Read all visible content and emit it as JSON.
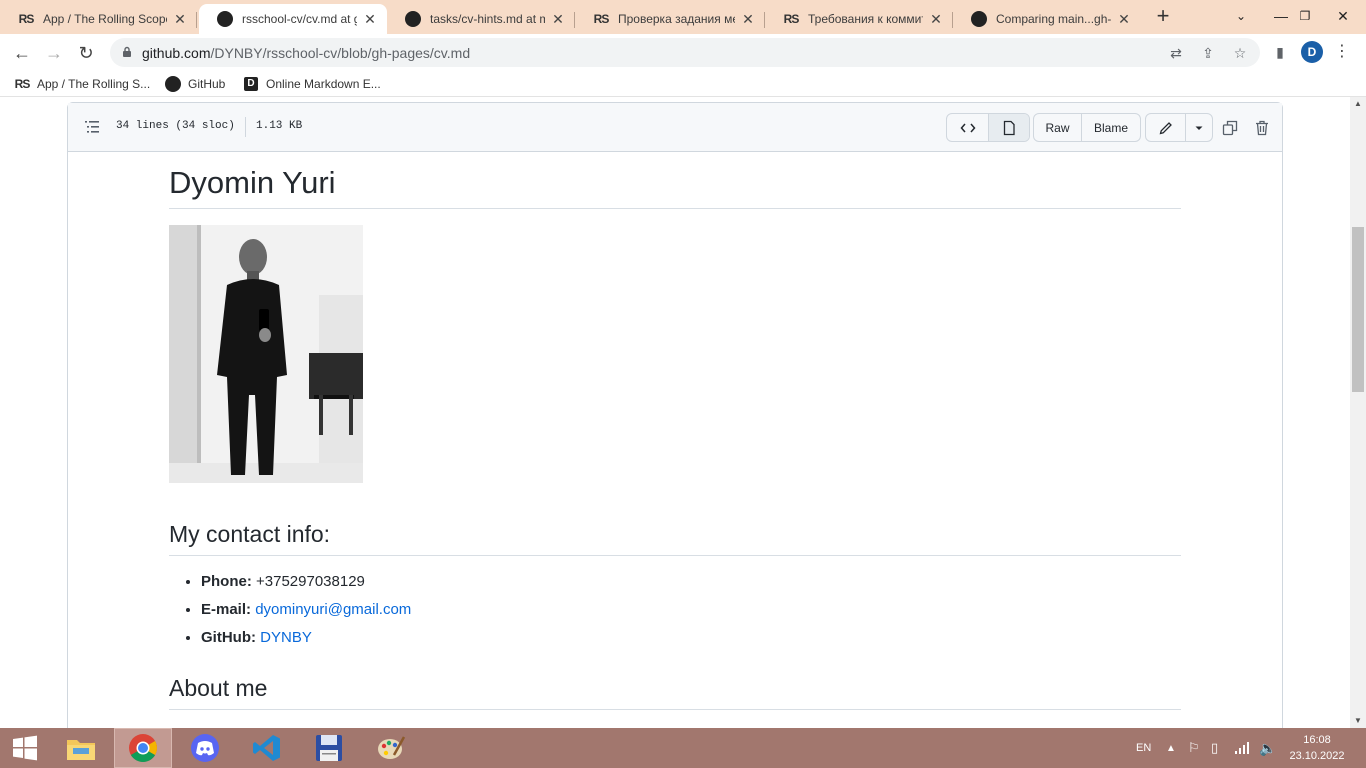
{
  "browser": {
    "tabs": [
      {
        "title": "App / The Rolling Scopes",
        "favicon": "rs-icon",
        "active": false
      },
      {
        "title": "rsschool-cv/cv.md at gh-pages",
        "favicon": "github-icon",
        "active": true
      },
      {
        "title": "tasks/cv-hints.md at master",
        "favicon": "github-icon",
        "active": false
      },
      {
        "title": "Проверка задания ментором",
        "favicon": "rs-icon",
        "active": false
      },
      {
        "title": "Требования к коммитам",
        "favicon": "rs-icon",
        "active": false
      },
      {
        "title": "Comparing main...gh-pages",
        "favicon": "github-icon",
        "active": false
      }
    ],
    "new_tab": "+",
    "address": {
      "host": "github.com",
      "path": "/DYNBY/rsschool-cv/blob/gh-pages/cv.md"
    },
    "profile_initial": "D",
    "bookmarks": [
      {
        "label": "App / The Rolling S...",
        "icon": "rs-icon"
      },
      {
        "label": "GitHub",
        "icon": "github-icon"
      },
      {
        "label": "Online Markdown E...",
        "icon": "d-icon"
      }
    ]
  },
  "file_header": {
    "lines": "34 lines (34 sloc)",
    "size": "1.13 KB",
    "raw_label": "Raw",
    "blame_label": "Blame"
  },
  "markdown": {
    "title": "Dyomin Yuri",
    "contact_heading": "My contact info:",
    "contacts": [
      {
        "label": "Phone:",
        "value": "+375297038129",
        "link": false
      },
      {
        "label": "E-mail:",
        "value": "dyominyuri@gmail.com",
        "link": true
      },
      {
        "label": "GitHub:",
        "value": "DYNBY",
        "link": true
      }
    ],
    "about_heading": "About me"
  },
  "taskbar": {
    "apps": [
      "file-explorer-icon",
      "chrome-icon",
      "discord-icon",
      "vscode-icon",
      "floppy-disk-icon",
      "paint-icon"
    ],
    "language": "EN",
    "time": "16:08",
    "date": "23.10.2022"
  },
  "colors": {
    "tabstrip": "#f7dcc8",
    "taskbar": "#a2776e",
    "link": "#0969da"
  }
}
